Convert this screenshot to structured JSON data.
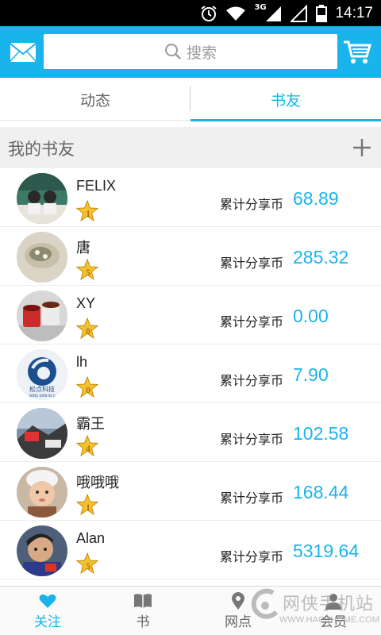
{
  "status_bar": {
    "time": "14:17",
    "network": "3G",
    "icons": [
      "alarm-icon",
      "wifi-icon",
      "signal-icon",
      "no-signal-icon",
      "battery-icon"
    ]
  },
  "header": {
    "search_placeholder": "搜索",
    "icons": [
      "mail-icon",
      "search-icon",
      "cart-icon"
    ],
    "accent_color": "#1ab4ec"
  },
  "tabs": [
    {
      "label": "动态",
      "active": false
    },
    {
      "label": "书友",
      "active": true
    }
  ],
  "section": {
    "title": "我的书友",
    "add_icon": "plus-icon"
  },
  "friends": [
    {
      "name": "FELIX",
      "level": "1",
      "share_label": "累计分享币",
      "share_value": "68.89"
    },
    {
      "name": "唐",
      "level": "5",
      "share_label": "累计分享币",
      "share_value": "285.32"
    },
    {
      "name": "XY",
      "level": "0",
      "share_label": "累计分享币",
      "share_value": "0.00"
    },
    {
      "name": "lh",
      "level": "0",
      "share_label": "累计分享币",
      "share_value": "7.90"
    },
    {
      "name": "霸王",
      "level": "4",
      "share_label": "累计分享币",
      "share_value": "102.58"
    },
    {
      "name": "哦哦哦",
      "level": "1",
      "share_label": "累计分享币",
      "share_value": "168.44"
    },
    {
      "name": "Alan",
      "level": "5",
      "share_label": "累计分享币",
      "share_value": "5319.64"
    }
  ],
  "avatar_texts": {
    "lh_logo": "松点科技",
    "lh_logo_sub": "SONG DIAN KE JI"
  },
  "bottom_nav": [
    {
      "label": "关注",
      "icon": "heart-icon",
      "active": true
    },
    {
      "label": "书",
      "icon": "book-icon",
      "active": false
    },
    {
      "label": "网点",
      "icon": "location-icon",
      "active": false
    },
    {
      "label": "会员",
      "icon": "member-icon",
      "active": false
    }
  ],
  "watermark": {
    "text": "网侠手机站",
    "url": "WWW.HACKHOME.COM"
  }
}
